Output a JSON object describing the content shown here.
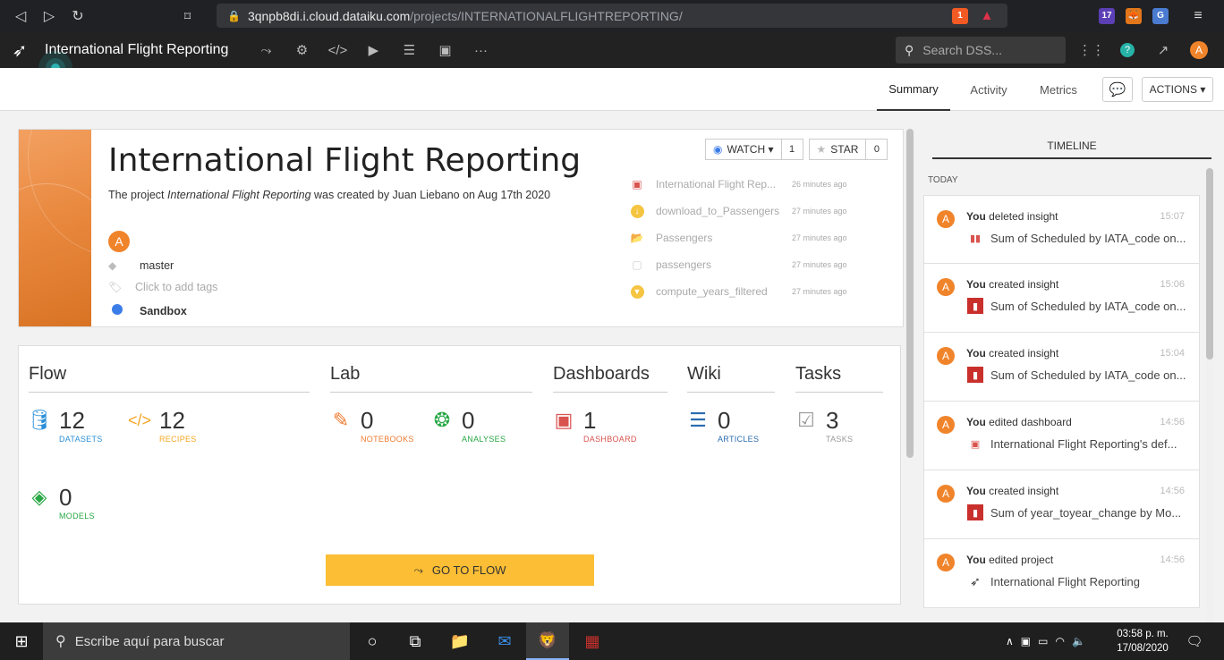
{
  "browser": {
    "url_host": "3qnpb8di.i.cloud.dataiku.com",
    "url_path": "/projects/INTERNATIONALFLIGHTREPORTING/",
    "brave_badge": "1",
    "ext_badge": "17"
  },
  "dss_nav": {
    "project_title": "International Flight Reporting",
    "search_placeholder": "Search DSS...",
    "user_initial": "A"
  },
  "tabs": [
    "Summary",
    "Activity",
    "Metrics"
  ],
  "actions_label": "ACTIONS",
  "project": {
    "title": "International Flight Reporting",
    "desc_prefix": "The project ",
    "desc_name": "International Flight Reporting",
    "desc_suffix": " was created by Juan Liebano on Aug 17th 2020",
    "owner_initial": "A",
    "branch": "master",
    "tags_placeholder": "Click to add tags",
    "status": "Sandbox",
    "watch_label": "WATCH",
    "watch_count": "1",
    "star_label": "STAR",
    "star_count": "0"
  },
  "recent_items": [
    {
      "name": "International Flight Rep...",
      "time": "26 minutes ago",
      "icon": "dashboard-icon",
      "color": "#d9534f"
    },
    {
      "name": "download_to_Passengers",
      "time": "27 minutes ago",
      "icon": "download-recipe-icon",
      "color": "#f5c542"
    },
    {
      "name": "Passengers",
      "time": "27 minutes ago",
      "icon": "folder-icon",
      "color": "#3aa0d8"
    },
    {
      "name": "passengers",
      "time": "27 minutes ago",
      "icon": "dataset-icon",
      "color": "#cccccc"
    },
    {
      "name": "compute_years_filtered",
      "time": "27 minutes ago",
      "icon": "filter-recipe-icon",
      "color": "#f5c542"
    }
  ],
  "summary": {
    "flow_title": "Flow",
    "lab_title": "Lab",
    "dashboards_title": "Dashboards",
    "wiki_title": "Wiki",
    "tasks_title": "Tasks",
    "datasets": {
      "count": "12",
      "label": "DATASETS",
      "color": "#2b90d9"
    },
    "recipes": {
      "count": "12",
      "label": "RECIPES",
      "color": "#f5a623"
    },
    "models": {
      "count": "0",
      "label": "MODELS",
      "color": "#28a745"
    },
    "notebooks": {
      "count": "0",
      "label": "NOTEBOOKS",
      "color": "#f07b30"
    },
    "analyses": {
      "count": "0",
      "label": "ANALYSES",
      "color": "#28a745"
    },
    "dashboard": {
      "count": "1",
      "label": "DASHBOARD",
      "color": "#d9534f"
    },
    "articles": {
      "count": "0",
      "label": "ARTICLES",
      "color": "#2b6cb0"
    },
    "tasks": {
      "count": "3",
      "label": "TASKS",
      "color": "#999999"
    },
    "goto_flow_label": "GO TO FLOW"
  },
  "timeline": {
    "header": "TIMELINE",
    "day_label": "TODAY",
    "items": [
      {
        "user": "You",
        "action": " deleted insight",
        "time": "15:07",
        "object": "Sum of Scheduled by IATA_code on...",
        "icon": "insight-icon"
      },
      {
        "user": "You",
        "action": " created insight",
        "time": "15:06",
        "object": "Sum of Scheduled by IATA_code on...",
        "icon": "insight-icon"
      },
      {
        "user": "You",
        "action": " created insight",
        "time": "15:04",
        "object": "Sum of Scheduled by IATA_code on...",
        "icon": "insight-icon"
      },
      {
        "user": "You",
        "action": " edited dashboard",
        "time": "14:56",
        "object": "International Flight Reporting's def...",
        "icon": "dashboard-icon"
      },
      {
        "user": "You",
        "action": " created insight",
        "time": "14:56",
        "object": "Sum of year_toyear_change by Mo...",
        "icon": "insight-icon"
      },
      {
        "user": "You",
        "action": " edited project",
        "time": "14:56",
        "object": "International Flight Reporting",
        "icon": "project-icon"
      }
    ]
  },
  "taskbar": {
    "search_placeholder": "Escribe aquí para buscar",
    "time": "03:58 p. m.",
    "date": "17/08/2020"
  }
}
